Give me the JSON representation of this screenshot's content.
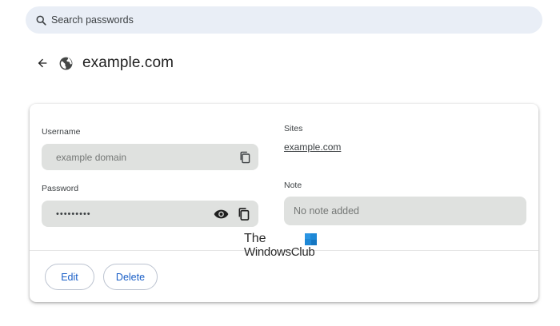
{
  "search": {
    "placeholder": "Search passwords",
    "icon": "search-icon"
  },
  "header": {
    "back_icon": "arrow-back-icon",
    "site_icon": "globe-icon",
    "title": "example.com"
  },
  "details": {
    "username": {
      "label": "Username",
      "value": "example domain",
      "copy_icon": "copy-icon"
    },
    "password": {
      "label": "Password",
      "value": "•••••••••",
      "show_icon": "eye-icon",
      "copy_icon": "copy-icon"
    },
    "sites": {
      "label": "Sites",
      "link": "example.com"
    },
    "note": {
      "label": "Note",
      "value": "No note added"
    }
  },
  "actions": {
    "edit_label": "Edit",
    "delete_label": "Delete"
  },
  "watermark": {
    "line1": "The",
    "line2": "WindowsClub"
  },
  "colors": {
    "accent": "#1a5fc7",
    "field_background": "#dfe1df",
    "search_background": "#e9eef6"
  }
}
